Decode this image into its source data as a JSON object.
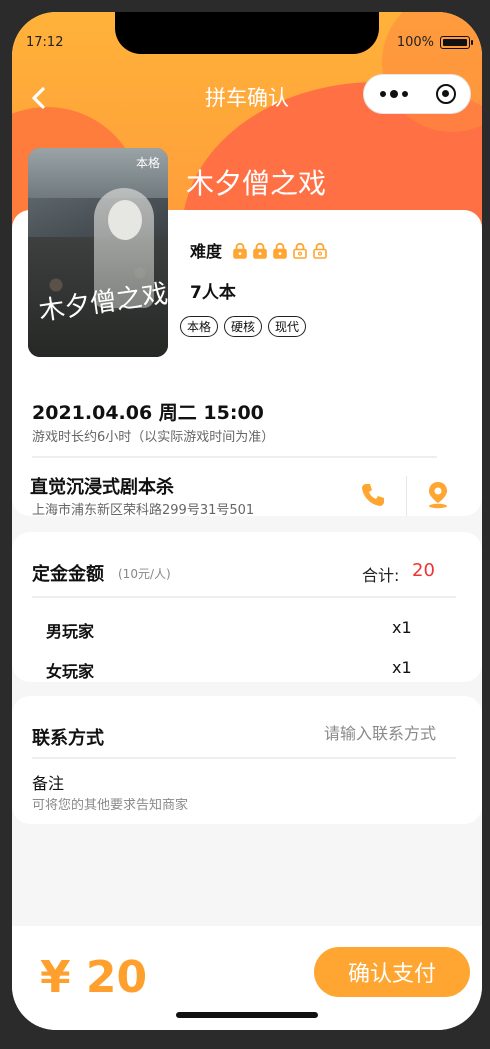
{
  "status_bar": {
    "time": "17:12",
    "battery_percent": "100%"
  },
  "nav": {
    "title": "拼车确认"
  },
  "game": {
    "title": "木夕僧之戏",
    "poster_tag": "本格",
    "poster_calligraphy": "木夕僧之戏",
    "difficulty_label": "难度",
    "difficulty_level": 3,
    "difficulty_max": 5,
    "players": "7人本",
    "tags": [
      "本格",
      "硬核",
      "现代"
    ]
  },
  "session": {
    "datetime": "2021.04.06 周二 15:00",
    "duration": "游戏时长约6小时（以实际游戏时间为准）"
  },
  "shop": {
    "name": "直觉沉浸式剧本杀",
    "address": "上海市浦东新区荣科路299号31号501"
  },
  "deposit": {
    "label": "定金金额",
    "per_person": "(10元/人)",
    "total_label": "合计:",
    "total_value": "20",
    "rows": [
      {
        "label": "男玩家",
        "qty": "x1"
      },
      {
        "label": "女玩家",
        "qty": "x1"
      }
    ]
  },
  "contact": {
    "label": "联系方式",
    "placeholder": "请输入联系方式",
    "remark_label": "备注",
    "remark_placeholder": "可将您的其他要求告知商家"
  },
  "footer": {
    "price": "¥ 20",
    "pay_label": "确认支付"
  },
  "colors": {
    "accent": "#ffa531",
    "total_red": "#e33333",
    "hero": "#ff7a3c"
  }
}
